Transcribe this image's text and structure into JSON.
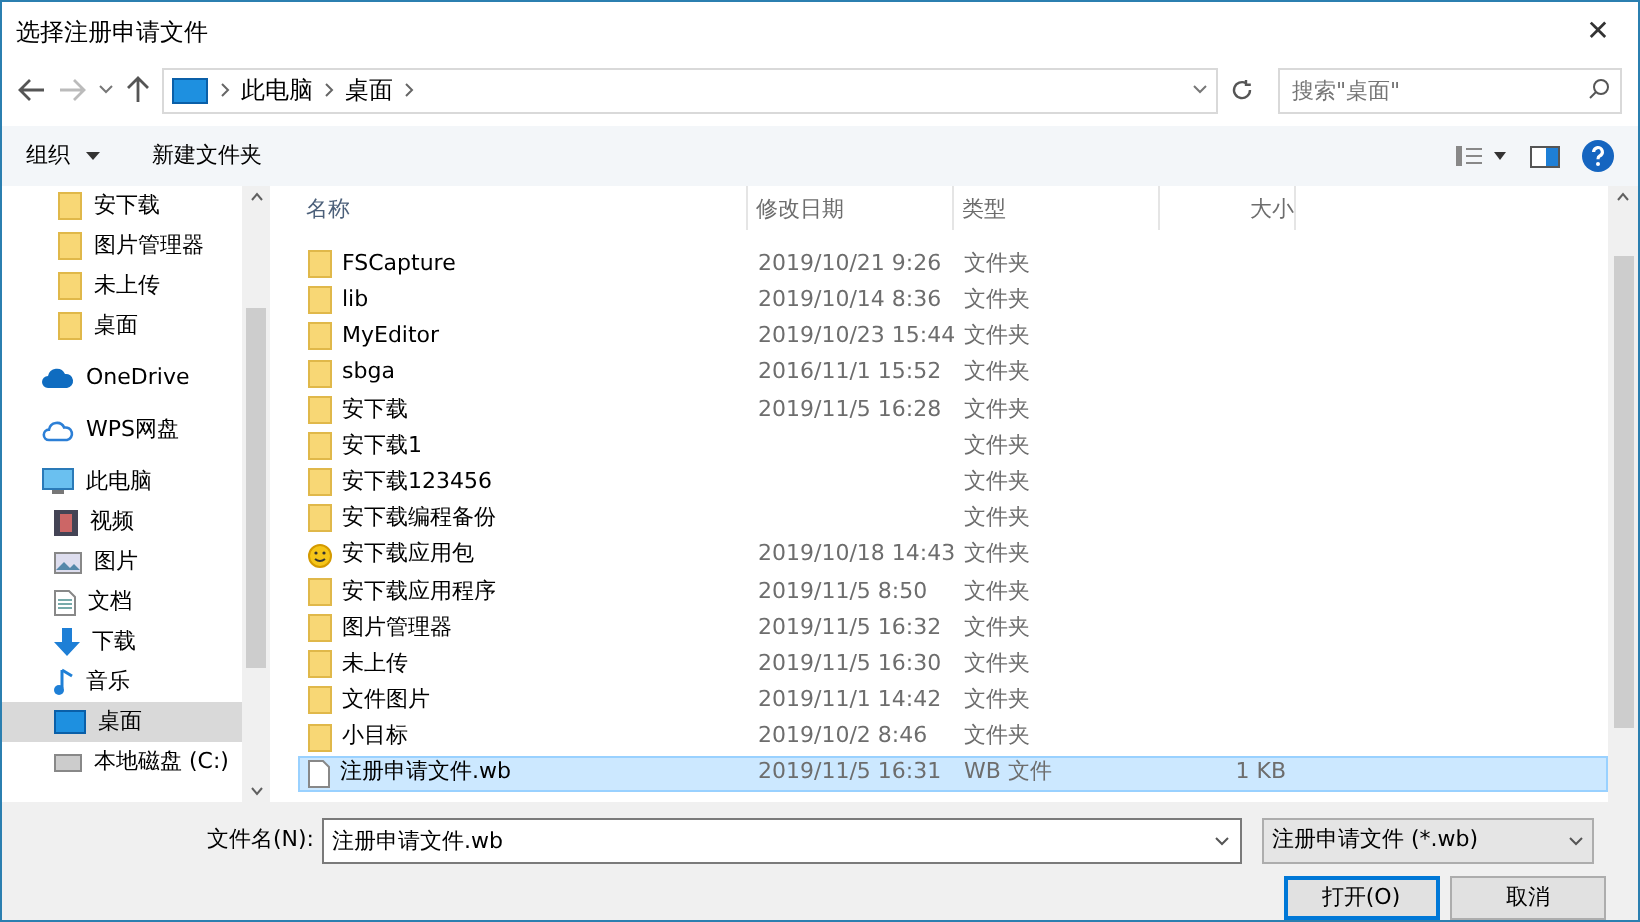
{
  "window": {
    "title": "选择注册申请文件",
    "close": "✕"
  },
  "nav": {
    "breadcrumb": [
      "此电脑",
      "桌面"
    ],
    "search": {
      "placeholder": "搜索\"桌面\""
    }
  },
  "toolbar": {
    "organize": "组织",
    "new_folder": "新建文件夹"
  },
  "sidebar": {
    "pinned": [
      {
        "label": "安下载",
        "kind": "folder",
        "selected": false
      },
      {
        "label": "图片管理器",
        "kind": "folder",
        "selected": false
      },
      {
        "label": "未上传",
        "kind": "folder",
        "selected": false
      },
      {
        "label": "桌面",
        "kind": "folder",
        "selected": false
      }
    ],
    "items": [
      {
        "label": "OneDrive",
        "kind": "onedrive",
        "selected": false
      },
      {
        "label": "WPS网盘",
        "kind": "cloud",
        "selected": false
      },
      {
        "label": "此电脑",
        "kind": "pc",
        "selected": false,
        "children": [
          {
            "label": "视频",
            "kind": "video",
            "selected": false
          },
          {
            "label": "图片",
            "kind": "picture",
            "selected": false
          },
          {
            "label": "文档",
            "kind": "doc",
            "selected": false
          },
          {
            "label": "下载",
            "kind": "download",
            "selected": false
          },
          {
            "label": "音乐",
            "kind": "music",
            "selected": false
          },
          {
            "label": "桌面",
            "kind": "desktop",
            "selected": true
          },
          {
            "label": "本地磁盘 (C:)",
            "kind": "drive",
            "selected": false
          }
        ]
      }
    ]
  },
  "table": {
    "columns": [
      "名称",
      "修改日期",
      "类型",
      "大小"
    ],
    "rows": [
      {
        "name": "FSCapture",
        "date": "2019/10/21 9:26",
        "type": "文件夹",
        "kind": "folder",
        "selected": false
      },
      {
        "name": "lib",
        "date": "2019/10/14 8:36",
        "type": "文件夹",
        "kind": "folder",
        "selected": false
      },
      {
        "name": "MyEditor",
        "date": "2019/10/23 15:44",
        "type": "文件夹",
        "kind": "folder",
        "selected": false
      },
      {
        "name": "sbga",
        "date": "2016/11/1 15:52",
        "type": "文件夹",
        "kind": "folder",
        "selected": false
      },
      {
        "name": "安下载",
        "date": "2019/11/5 16:28",
        "type": "文件夹",
        "kind": "folder",
        "selected": false
      },
      {
        "name": "安下载1",
        "type": "文件夹",
        "kind": "folder",
        "selected": false
      },
      {
        "name": "安下载123456",
        "type": "文件夹",
        "kind": "folder",
        "selected": false
      },
      {
        "name": "安下载编程备份",
        "type": "文件夹",
        "kind": "folder",
        "selected": false
      },
      {
        "name": "安下载应用包",
        "date": "2019/10/18 14:43",
        "type": "文件夹",
        "kind": "app",
        "selected": false
      },
      {
        "name": "安下载应用程序",
        "date": "2019/11/5 8:50",
        "type": "文件夹",
        "kind": "folder",
        "selected": false
      },
      {
        "name": "图片管理器",
        "date": "2019/11/5 16:32",
        "type": "文件夹",
        "kind": "folder",
        "selected": false
      },
      {
        "name": "未上传",
        "date": "2019/11/5 16:30",
        "type": "文件夹",
        "kind": "folder",
        "selected": false
      },
      {
        "name": "文件图片",
        "date": "2019/11/1 14:42",
        "type": "文件夹",
        "kind": "folder",
        "selected": false
      },
      {
        "name": "小目标",
        "date": "2019/10/2 8:46",
        "type": "文件夹",
        "kind": "folder",
        "selected": false
      },
      {
        "name": "注册申请文件.wb",
        "date": "2019/11/5 16:31",
        "type": "WB 文件",
        "size": "1 KB",
        "kind": "file",
        "selected": true
      }
    ]
  },
  "footer": {
    "filename_label": "文件名(N):",
    "filename": "注册申请文件.wb",
    "filter": "注册申请文件 (*.wb)",
    "open": "打开(O)",
    "cancel": "取消"
  }
}
